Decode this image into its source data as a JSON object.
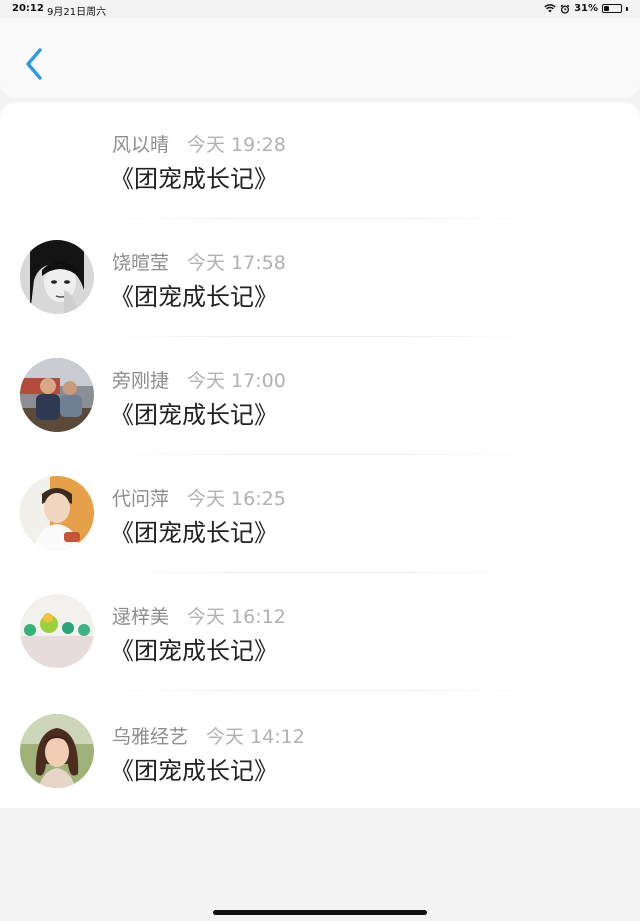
{
  "status_bar": {
    "time": "20:12",
    "date": "9月21日周六",
    "battery": "31%",
    "battery_level": 0.31
  },
  "nav": {
    "back_icon": "chevron-left-icon",
    "accent": "#2b9be8"
  },
  "items": [
    {
      "name": "风以晴",
      "time": "今天 19:28",
      "title": "《团宠成长记》",
      "avatar": "none"
    },
    {
      "name": "饶暄莹",
      "time": "今天 17:58",
      "title": "《团宠成长记》",
      "avatar": "bw-portrait"
    },
    {
      "name": "旁刚捷",
      "time": "今天 17:00",
      "title": "《团宠成长记》",
      "avatar": "outdoor-photo"
    },
    {
      "name": "代问萍",
      "time": "今天 16:25",
      "title": "《团宠成长记》",
      "avatar": "young-man-photo"
    },
    {
      "name": "逯梓美",
      "time": "今天 16:12",
      "title": "《团宠成长记》",
      "avatar": "green-toys-photo"
    },
    {
      "name": "乌雅经艺",
      "time": "今天 14:12",
      "title": "《团宠成长记》",
      "avatar": "woman-photo"
    }
  ]
}
